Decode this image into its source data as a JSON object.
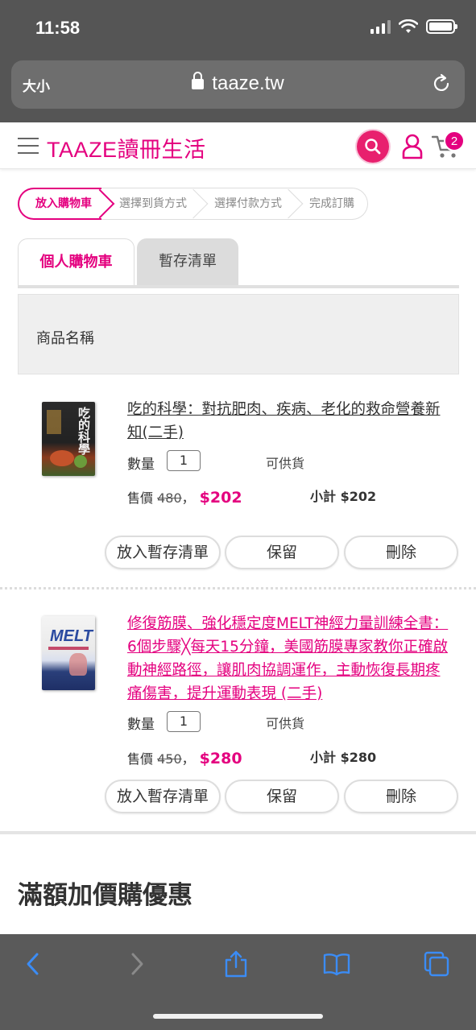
{
  "status_bar": {
    "time": "11:58"
  },
  "browser": {
    "text_size": "大小",
    "url": "taaze.tw"
  },
  "site": {
    "logo": "TAAZE讀冊生活",
    "cart_count": "2"
  },
  "steps": [
    "放入購物車",
    "選擇到貨方式",
    "選擇付款方式",
    "完成訂購"
  ],
  "tabs": {
    "personal_cart": "個人購物車",
    "saved_list": "暫存清單"
  },
  "table_header": {
    "product_name": "商品名稱"
  },
  "items": [
    {
      "title": "吃的科學：對抗肥肉、疾病、老化的救命營養新知(二手)",
      "qty_label": "數量",
      "qty": "1",
      "stock": "可供貨",
      "price_label": "售價",
      "orig_price": "480",
      "sep": "，",
      "sale_price": "$202",
      "subtotal": "小計 $202",
      "btn_save": "放入暫存清單",
      "btn_keep": "保留",
      "btn_delete": "刪除"
    },
    {
      "title": "修復筋膜、強化穩定度MELT神經力量訓練全書：6個步驟╳每天15分鐘，美國筋膜專家教你正確啟動神經路徑，讓肌肉協調運作，主動恢復長期疼痛傷害，提升運動表現 (二手)",
      "qty_label": "數量",
      "qty": "1",
      "stock": "可供貨",
      "price_label": "售價",
      "orig_price": "450",
      "sep": "，",
      "sale_price": "$280",
      "subtotal": "小計 $280",
      "btn_save": "放入暫存清單",
      "btn_keep": "保留",
      "btn_delete": "刪除"
    }
  ],
  "promo": {
    "title": "滿額加價購優惠"
  },
  "colors": {
    "brand": "#e4007f",
    "chrome": "#555555"
  }
}
